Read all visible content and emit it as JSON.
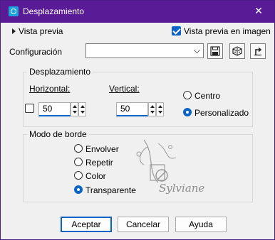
{
  "window": {
    "title": "Desplazamiento",
    "title_bar_color": "#5a1b97",
    "accent": "#0a64c4"
  },
  "preview": {
    "toggle_label": "Vista previa",
    "checkbox_label": "Vista previa en imagen",
    "checked": true
  },
  "config": {
    "label": "Configuración",
    "value": ""
  },
  "offset": {
    "group_title": "Desplazamiento",
    "horizontal_label": "Horizontal:",
    "horizontal_value": "50",
    "vertical_label": "Vertical:",
    "vertical_value": "50",
    "center_label": "Centro",
    "custom_label": "Personalizado",
    "selected": "Personalizado"
  },
  "edge": {
    "group_title": "Modo de borde",
    "options": [
      "Envolver",
      "Repetir",
      "Color",
      "Transparente"
    ],
    "selected": "Transparente"
  },
  "watermark": {
    "text": "Sylviane"
  },
  "buttons": {
    "ok": "Aceptar",
    "cancel": "Cancelar",
    "help": "Ayuda"
  }
}
